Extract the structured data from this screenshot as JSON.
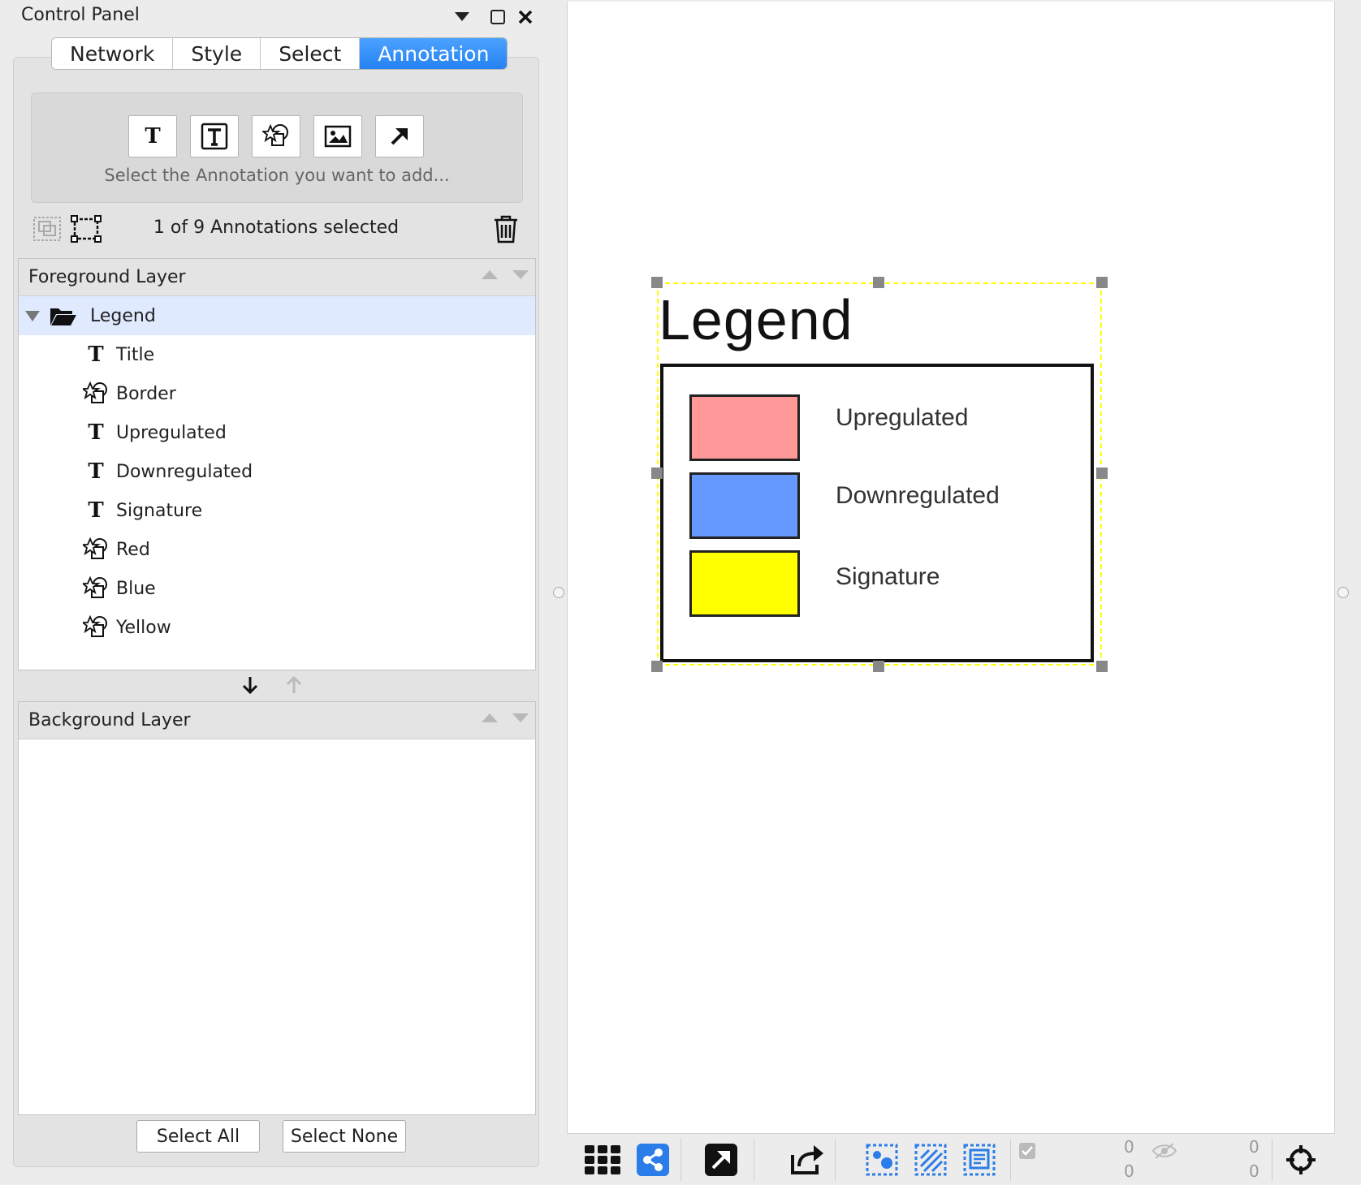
{
  "panel": {
    "title": "Control Panel",
    "tabs": [
      {
        "label": "Network",
        "active": false
      },
      {
        "label": "Style",
        "active": false
      },
      {
        "label": "Select",
        "active": false
      },
      {
        "label": "Annotation",
        "active": true
      }
    ],
    "add_hint": "Select the Annotation you want to add...",
    "tools": [
      "text-icon",
      "bounded-text-icon",
      "shape-icon",
      "image-icon",
      "arrow-icon"
    ],
    "status": "1 of 9 Annotations selected",
    "foreground": {
      "title": "Foreground Layer",
      "group": {
        "label": "Legend",
        "icon": "folder-open-icon"
      },
      "items": [
        {
          "label": "Title",
          "icon": "text-icon"
        },
        {
          "label": "Border",
          "icon": "shape-icon"
        },
        {
          "label": "Upregulated",
          "icon": "text-icon"
        },
        {
          "label": "Downregulated",
          "icon": "text-icon"
        },
        {
          "label": "Signature",
          "icon": "text-icon"
        },
        {
          "label": "Red",
          "icon": "shape-icon"
        },
        {
          "label": "Blue",
          "icon": "shape-icon"
        },
        {
          "label": "Yellow",
          "icon": "shape-icon"
        }
      ]
    },
    "background": {
      "title": "Background Layer"
    },
    "buttons": {
      "select_all": "Select All",
      "select_none": "Select None"
    }
  },
  "canvas": {
    "legend_title": "Legend",
    "entries": [
      {
        "label": "Upregulated",
        "color": "#ff9999"
      },
      {
        "label": "Downregulated",
        "color": "#6699ff"
      },
      {
        "label": "Signature",
        "color": "#ffff00"
      }
    ],
    "selection_color": "#ffff00"
  },
  "toolbar": {
    "counts": {
      "selected_nodes": "0",
      "total_nodes": "0",
      "hidden_nodes": "0",
      "hidden_edges": "0"
    },
    "accent": "#2b7de9"
  }
}
